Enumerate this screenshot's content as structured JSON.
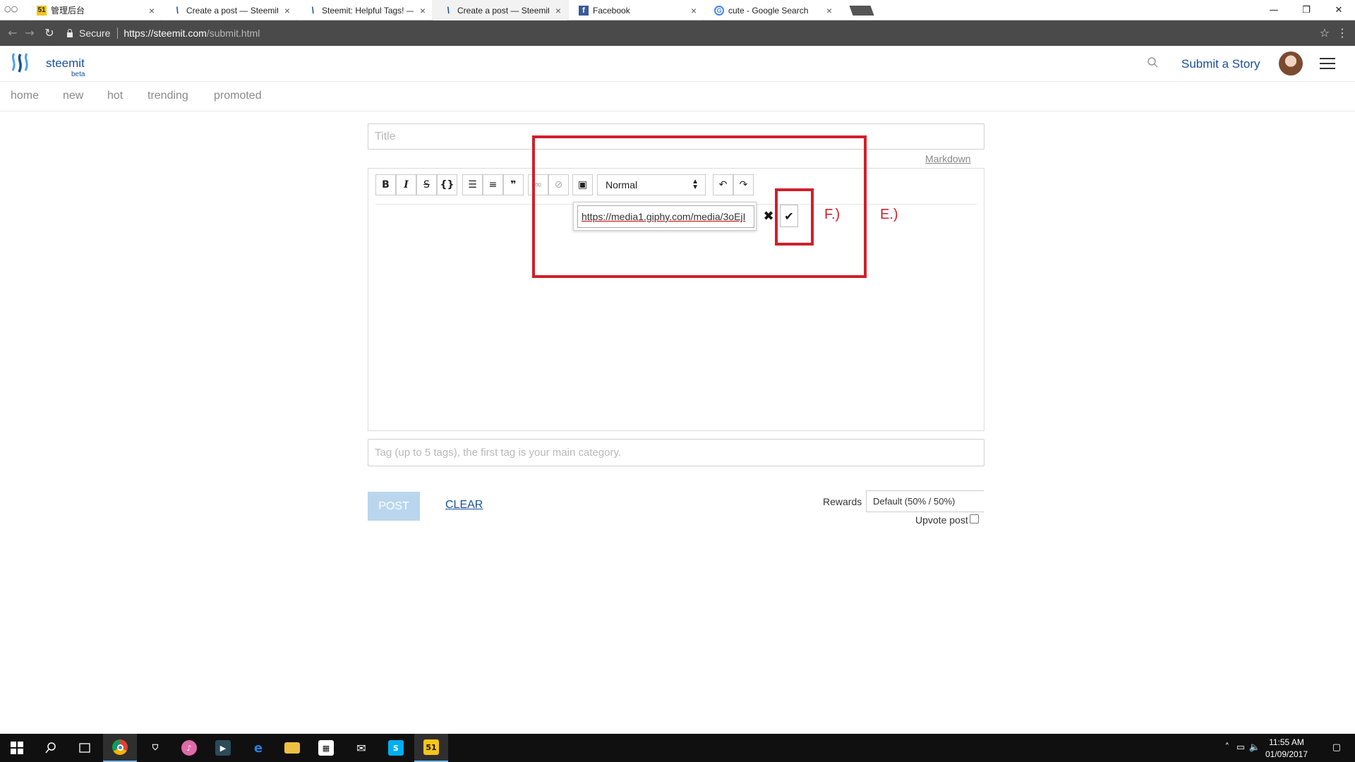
{
  "browser": {
    "tabs": [
      {
        "title": "管理后台",
        "favicon": "51-icon",
        "active": false
      },
      {
        "title": "Create a post — Steemit",
        "favicon": "steemit-icon",
        "active": false
      },
      {
        "title": "Steemit: Helpful Tags! —",
        "favicon": "steemit-icon",
        "active": false
      },
      {
        "title": "Create a post — Steemit",
        "favicon": "steemit-icon",
        "active": true
      },
      {
        "title": "Facebook",
        "favicon": "facebook-icon",
        "active": false
      },
      {
        "title": "cute - Google Search",
        "favicon": "google-icon",
        "active": false
      }
    ],
    "secure_label": "Secure",
    "url_host": "https://steemit.com",
    "url_path": "/submit.html"
  },
  "site": {
    "brand": "steemit",
    "beta": "beta",
    "submit_label": "Submit a Story",
    "nav": [
      "home",
      "new",
      "hot",
      "trending",
      "promoted"
    ],
    "accent": "#1a5099"
  },
  "editor": {
    "title_placeholder": "Title",
    "markdown_link": "Markdown",
    "format_value": "Normal",
    "image_url_value": "https://media1.giphy.com/media/3oEjI",
    "tags_placeholder": "Tag (up to 5 tags), the first tag is your main category.",
    "post_label": "POST",
    "clear_label": "CLEAR",
    "rewards_label": "Rewards",
    "rewards_value": "Default (50% / 50%)",
    "upvote_label": "Upvote post"
  },
  "annotations": {
    "label_f": "F.)",
    "label_e": "E.)",
    "color": "#d0202a"
  },
  "taskbar": {
    "time": "11:55 AM",
    "date": "01/09/2017"
  }
}
